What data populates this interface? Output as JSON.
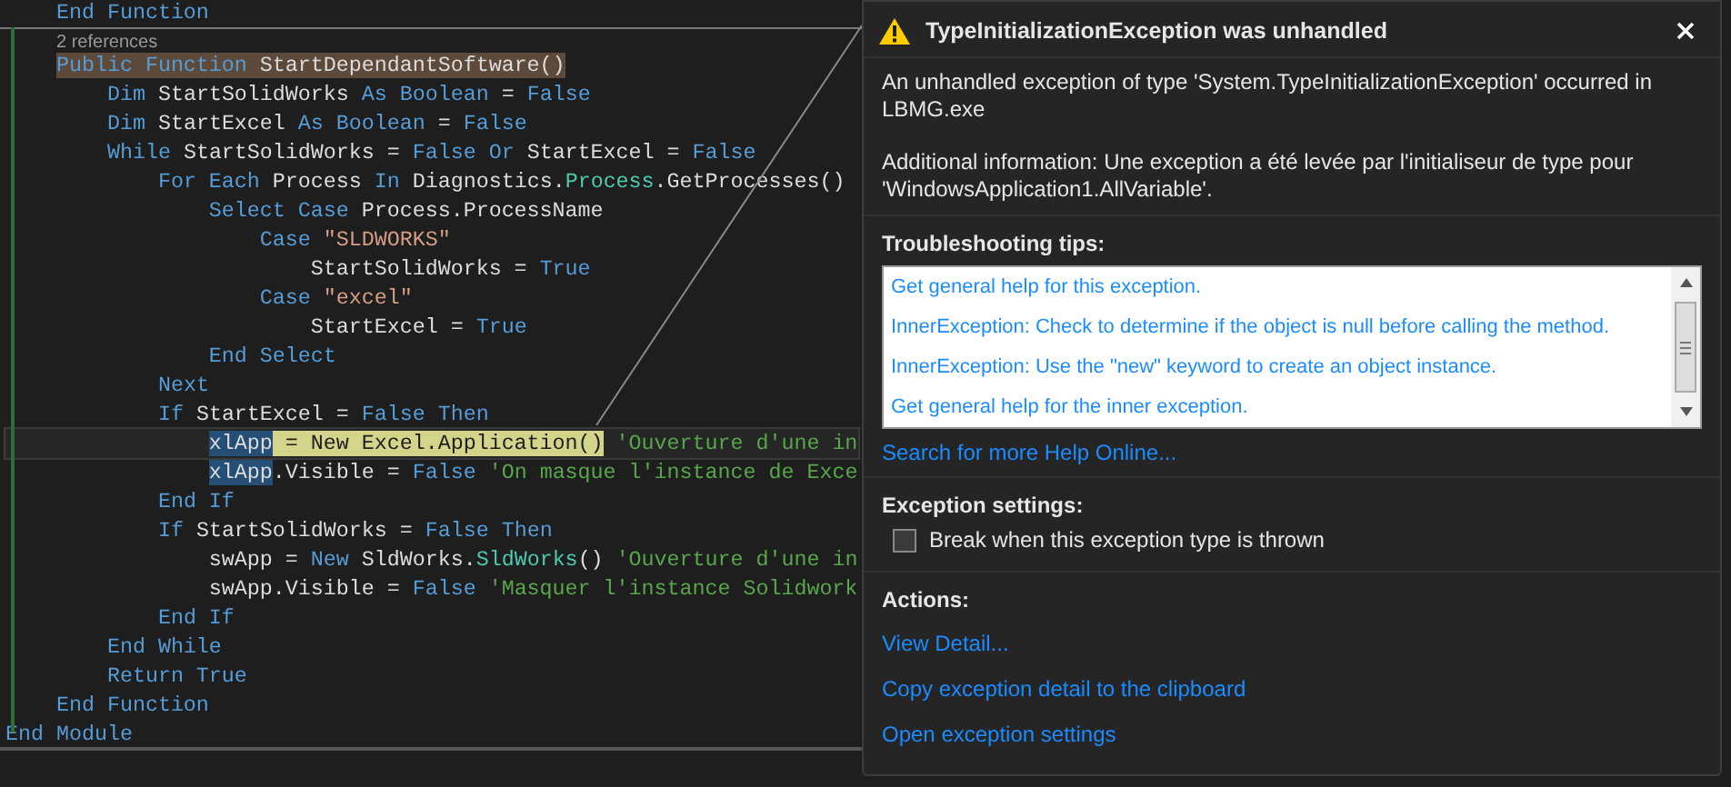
{
  "editor": {
    "lines": [
      {
        "kind": "code",
        "segments": [
          {
            "text": "    End Function",
            "kind": "keyword"
          }
        ]
      },
      {
        "kind": "codelens",
        "text": "2 references"
      },
      {
        "kind": "code",
        "segments": [
          {
            "text": "    Public Function",
            "kind": "keyword",
            "reference_highlight": true
          },
          {
            "text": " StartDependantSoftware()",
            "kind": "plain",
            "reference_highlight": true
          }
        ]
      },
      {
        "kind": "code",
        "segments": [
          {
            "text": "        Dim",
            "kind": "keyword"
          },
          {
            "text": " StartSolidWorks ",
            "kind": "plain"
          },
          {
            "text": "As Boolean",
            "kind": "keyword"
          },
          {
            "text": " = ",
            "kind": "plain"
          },
          {
            "text": "False",
            "kind": "keyword"
          }
        ]
      },
      {
        "kind": "code",
        "segments": [
          {
            "text": "        Dim",
            "kind": "keyword"
          },
          {
            "text": " StartExcel ",
            "kind": "plain"
          },
          {
            "text": "As Boolean",
            "kind": "keyword"
          },
          {
            "text": " = ",
            "kind": "plain"
          },
          {
            "text": "False",
            "kind": "keyword"
          }
        ]
      },
      {
        "kind": "code",
        "segments": [
          {
            "text": "        While",
            "kind": "keyword"
          },
          {
            "text": " StartSolidWorks = ",
            "kind": "plain"
          },
          {
            "text": "False Or",
            "kind": "keyword"
          },
          {
            "text": " StartExcel = ",
            "kind": "plain"
          },
          {
            "text": "False",
            "kind": "keyword"
          }
        ]
      },
      {
        "kind": "code",
        "segments": [
          {
            "text": "            For Each",
            "kind": "keyword"
          },
          {
            "text": " Process ",
            "kind": "plain"
          },
          {
            "text": "In",
            "kind": "keyword"
          },
          {
            "text": " Diagnostics.",
            "kind": "plain"
          },
          {
            "text": "Process",
            "kind": "type"
          },
          {
            "text": ".GetProcesses()",
            "kind": "plain"
          }
        ]
      },
      {
        "kind": "code",
        "segments": [
          {
            "text": "                Select Case",
            "kind": "keyword"
          },
          {
            "text": " Process.ProcessName",
            "kind": "plain"
          }
        ]
      },
      {
        "kind": "code",
        "segments": [
          {
            "text": "                    Case",
            "kind": "keyword"
          },
          {
            "text": " \"SLDWORKS\"",
            "kind": "string"
          }
        ]
      },
      {
        "kind": "code",
        "segments": [
          {
            "text": "                        StartSolidWorks = ",
            "kind": "plain"
          },
          {
            "text": "True",
            "kind": "keyword"
          }
        ]
      },
      {
        "kind": "code",
        "segments": [
          {
            "text": "                    Case",
            "kind": "keyword"
          },
          {
            "text": " \"excel\"",
            "kind": "string"
          }
        ]
      },
      {
        "kind": "code",
        "segments": [
          {
            "text": "                        StartExcel = ",
            "kind": "plain"
          },
          {
            "text": "True",
            "kind": "keyword"
          }
        ]
      },
      {
        "kind": "code",
        "segments": [
          {
            "text": "                End Select",
            "kind": "keyword"
          }
        ]
      },
      {
        "kind": "code",
        "segments": [
          {
            "text": "            Next",
            "kind": "keyword"
          }
        ]
      },
      {
        "kind": "code",
        "segments": [
          {
            "text": "            If",
            "kind": "keyword"
          },
          {
            "text": " StartExcel = ",
            "kind": "plain"
          },
          {
            "text": "False Then",
            "kind": "keyword"
          }
        ]
      },
      {
        "kind": "code",
        "current": true,
        "segments": [
          {
            "text": "                xlApp",
            "kind": "plain",
            "selection_highlight": true
          },
          {
            "text": " = New Excel.Application()",
            "kind": "plain",
            "statement_highlight": true
          },
          {
            "text": " 'Ouverture d'une in",
            "kind": "comment"
          }
        ]
      },
      {
        "kind": "code",
        "segments": [
          {
            "text": "                xlApp",
            "kind": "plain",
            "selection_highlight": true
          },
          {
            "text": ".Visible = ",
            "kind": "plain"
          },
          {
            "text": "False",
            "kind": "keyword"
          },
          {
            "text": " 'On masque l'instance de Exce",
            "kind": "comment"
          }
        ]
      },
      {
        "kind": "code",
        "segments": [
          {
            "text": "            End If",
            "kind": "keyword"
          }
        ]
      },
      {
        "kind": "code",
        "segments": [
          {
            "text": "            If",
            "kind": "keyword"
          },
          {
            "text": " StartSolidWorks = ",
            "kind": "plain"
          },
          {
            "text": "False Then",
            "kind": "keyword"
          }
        ]
      },
      {
        "kind": "code",
        "segments": [
          {
            "text": "                swApp = ",
            "kind": "plain"
          },
          {
            "text": "New",
            "kind": "keyword"
          },
          {
            "text": " SldWorks.",
            "kind": "plain"
          },
          {
            "text": "SldWorks",
            "kind": "type"
          },
          {
            "text": "() ",
            "kind": "plain"
          },
          {
            "text": "'Ouverture d'une in",
            "kind": "comment"
          }
        ]
      },
      {
        "kind": "code",
        "segments": [
          {
            "text": "                swApp.Visible = ",
            "kind": "plain"
          },
          {
            "text": "False",
            "kind": "keyword"
          },
          {
            "text": " 'Masquer l'instance Solidwork",
            "kind": "comment"
          }
        ]
      },
      {
        "kind": "code",
        "segments": [
          {
            "text": "            End If",
            "kind": "keyword"
          }
        ]
      },
      {
        "kind": "code",
        "segments": [
          {
            "text": "        End While",
            "kind": "keyword"
          }
        ]
      },
      {
        "kind": "code",
        "segments": [
          {
            "text": "        Return True",
            "kind": "keyword"
          }
        ]
      },
      {
        "kind": "code",
        "segments": [
          {
            "text": "    End Function",
            "kind": "keyword"
          }
        ]
      },
      {
        "kind": "code",
        "segments": [
          {
            "text": "End Module",
            "kind": "keyword"
          }
        ]
      }
    ]
  },
  "exception_popup": {
    "title": "TypeInitializationException was unhandled",
    "message": "An unhandled exception of type 'System.TypeInitializationException' occurred in LBMG.exe",
    "additional_information": "Additional information: Une exception a été levée par l'initialiseur de type pour 'WindowsApplication1.AllVariable'.",
    "troubleshooting": {
      "heading": "Troubleshooting tips:",
      "tips": [
        "Get general help for this exception.",
        "InnerException: Check to determine if the object is null before calling the method.",
        "InnerException: Use the \"new\" keyword to create an object instance.",
        "Get general help for the inner exception."
      ],
      "more_help_link": "Search for more Help Online..."
    },
    "exception_settings": {
      "heading": "Exception settings:",
      "checkbox": {
        "label": "Break when this exception type is thrown",
        "checked": false
      }
    },
    "actions": {
      "heading": "Actions:",
      "links": [
        "View Detail...",
        "Copy exception detail to the clipboard",
        "Open exception settings"
      ]
    }
  }
}
